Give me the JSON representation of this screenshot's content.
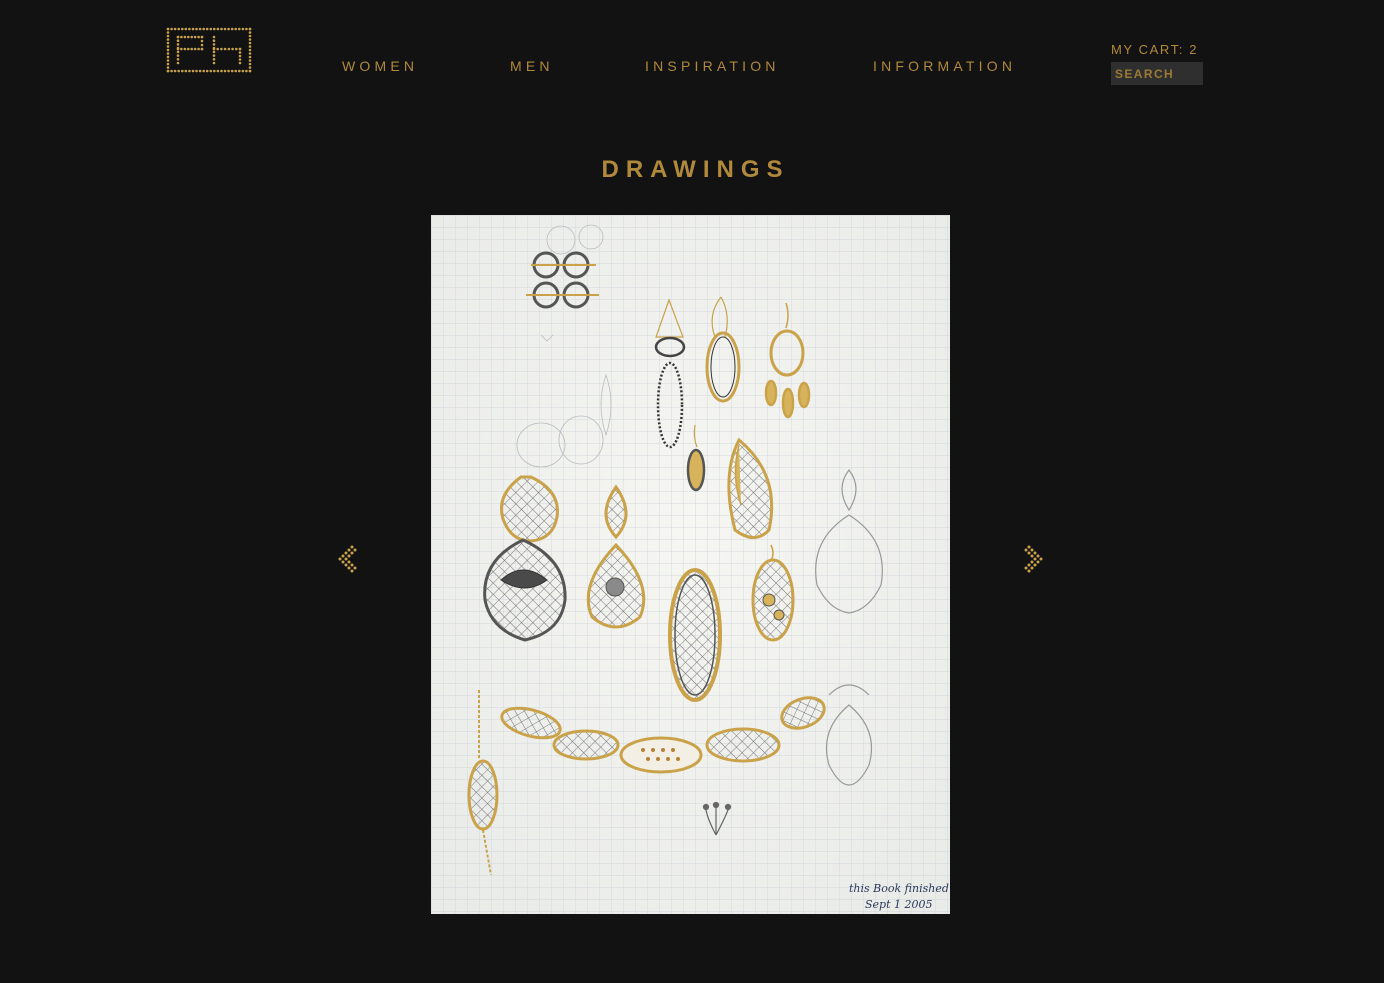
{
  "brand": {
    "logo_monogram": "PH",
    "accent_color": "#b08a3a",
    "background_color": "#121212"
  },
  "nav": {
    "items": [
      {
        "label": "WOMEN"
      },
      {
        "label": "MEN"
      },
      {
        "label": "INSPIRATION"
      },
      {
        "label": "INFORMATION"
      }
    ]
  },
  "cart": {
    "label": "MY CART: 2"
  },
  "search": {
    "placeholder": "SEARCH",
    "icon": "none"
  },
  "main": {
    "title": "DRAWINGS",
    "prev_icon": "chevron-left-icon",
    "next_icon": "chevron-right-icon",
    "drawing": {
      "signature_line1": "this Book finished",
      "signature_line2": "Sept 1 2005"
    }
  }
}
